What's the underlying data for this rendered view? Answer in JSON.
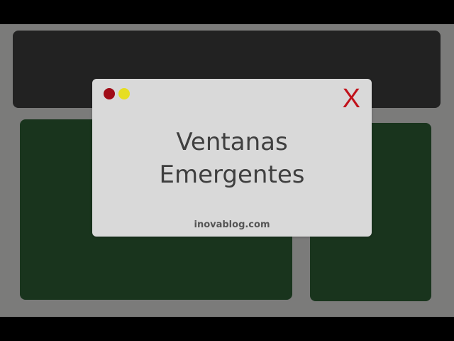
{
  "popup": {
    "title_line1": "Ventanas",
    "title_line2": "Emergentes",
    "close_label": "X",
    "footer": "inovablog.com"
  },
  "colors": {
    "background": "#7b7b7a",
    "header": "#222222",
    "panels": "#19341d",
    "popup": "#d9d9d9",
    "dot_red": "#a00c17",
    "dot_yellow": "#e6de22",
    "close": "#c1121b"
  }
}
